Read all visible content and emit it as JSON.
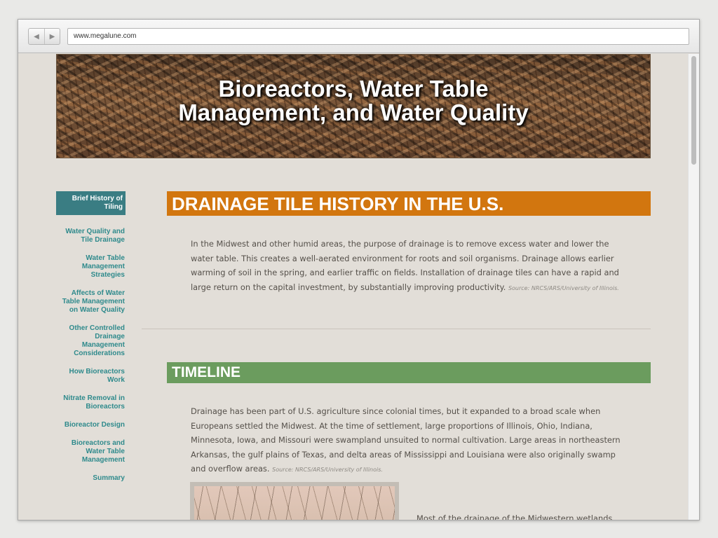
{
  "browser": {
    "url": "www.megalune.com",
    "back_glyph": "◀",
    "forward_glyph": "▶"
  },
  "banner": {
    "title_line1": "Bioreactors, Water Table",
    "title_line2": "Management, and Water Quality"
  },
  "nav": {
    "items": [
      {
        "label": "Brief History of Tiling",
        "active": true
      },
      {
        "label": "Water Quality and Tile Drainage"
      },
      {
        "label": "Water Table Management Strategies"
      },
      {
        "label": "Affects of Water Table Management on Water Quality"
      },
      {
        "label": "Other Controlled Drainage Management Considerations"
      },
      {
        "label": "How Bioreactors Work"
      },
      {
        "label": "Nitrate Removal in Bioreactors"
      },
      {
        "label": "Bioreactor Design"
      },
      {
        "label": "Bioreactors and Water Table Management"
      },
      {
        "label": "Summary"
      }
    ]
  },
  "sections": [
    {
      "heading": "DRAINAGE TILE HISTORY IN THE U.S.",
      "body": "In the Midwest and other humid areas, the purpose of drainage is to remove excess water and lower the water table. This creates a well-aerated environment for roots and soil organisms. Drainage allows earlier warming of soil in the spring, and earlier traffic on fields. Installation of drainage tiles can have a rapid and large return on the capital investment, by substantially improving productivity.",
      "source": "Source: NRCS/ARS/University of Illinois."
    },
    {
      "heading": "TIMELINE",
      "body": "Drainage has been part of U.S. agriculture since colonial times, but it expanded to a broad scale when Europeans settled the Midwest. At the time of settlement, large proportions of Illinois, Ohio, Indiana, Minnesota, Iowa, and Missouri were swampland unsuited to normal cultivation. Large areas in northeastern Arkansas, the gulf plains of Texas, and delta areas of Mississippi and Louisiana were also originally swamp and overflow areas.",
      "source": "Source: NRCS/ARS/University of Illinois."
    }
  ],
  "partial_caption": "Most of the drainage of the Midwestern wetlands",
  "colors": {
    "accent_orange": "#d2760f",
    "accent_green": "#6b9c5e",
    "nav_teal": "#2f8a8c",
    "nav_active_bg": "#3a7d83"
  }
}
